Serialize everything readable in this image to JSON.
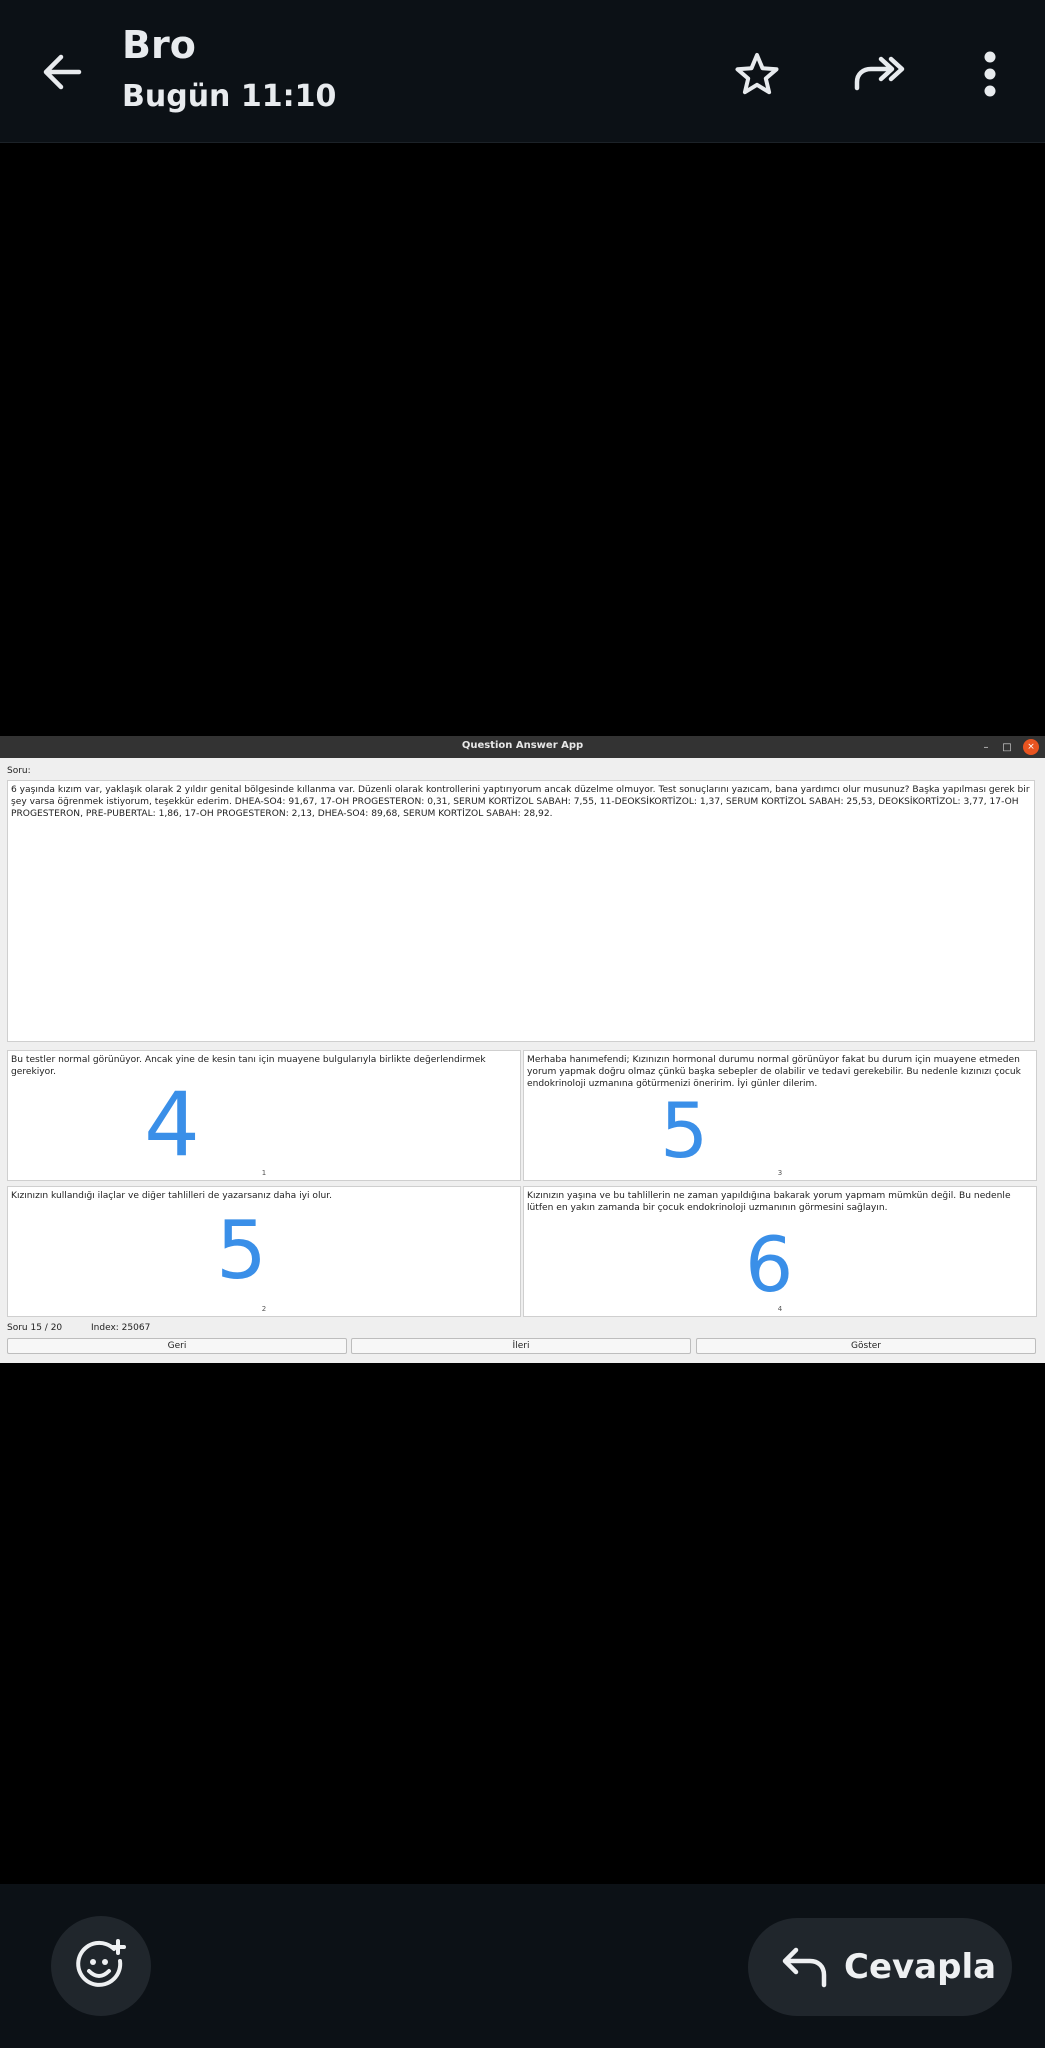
{
  "header": {
    "title": "Bro",
    "subtitle": "Bugün 11:10",
    "icons": [
      "back-arrow-icon",
      "star-icon",
      "forward-icon",
      "more-vertical-icon"
    ]
  },
  "app_window": {
    "title": "Question Answer App",
    "controls": [
      "–",
      "□",
      "×"
    ],
    "soru_label": "Soru:",
    "question_text": "6 yaşında kızım var, yaklaşık olarak 2 yıldır genital bölgesinde kıllanma var. Düzenli olarak kontrollerini yaptırıyorum ancak düzelme olmuyor. Test sonuçlarını yazıcam, bana yardımcı olur musunuz? Başka yapılması gerek bir şey varsa öğrenmek istiyorum, teşekkür ederim. DHEA-SO4: 91,67, 17-OH PROGESTERON: 0,31, SERUM KORTİZOL SABAH: 7,55, 11-DEOKSİKORTİZOL: 1,37, SERUM KORTİZOL SABAH: 25,53, DEOKSİKORTİZOL: 3,77, 17-OH PROGESTERON, PRE-PUBERTAL: 1,86, 17-OH PROGESTERON: 2,13, DHEA-SO4: 89,68, SERUM KORTİZOL SABAH: 28,92.",
    "answers": [
      {
        "text": "Bu testler normal görünüyor. Ancak yine de kesin tanı için muayene bulgularıyla birlikte değerlendirmek gerekiyor.",
        "number": "1",
        "score": "4"
      },
      {
        "text": "Kızınızın kullandığı ilaçlar ve diğer tahlilleri de yazarsanız daha iyi olur.",
        "number": "2",
        "score": "5"
      },
      {
        "text": "Merhaba hanımefendi; Kızınızın hormonal durumu normal görünüyor fakat bu durum için muayene etmeden yorum yapmak doğru olmaz çünkü başka sebepler de olabilir ve tedavi gerekebilir. Bu nedenle kızınızı çocuk endokrinoloji uzmanına götürmenizi öneririm. İyi günler dilerim.",
        "number": "3",
        "score": "5"
      },
      {
        "text": "Kızınızın yaşına ve bu tahlillerin ne zaman yapıldığına bakarak yorum yapmam mümkün değil. Bu nedenle lütfen en yakın zamanda bir çocuk endokrinoloji uzmanının görmesini sağlayın.",
        "number": "4",
        "score": "6"
      }
    ],
    "status": {
      "progress": "Soru 15 / 20",
      "index": "Index: 25067"
    },
    "buttons": {
      "back": "Geri",
      "next": "İleri",
      "show": "Göster"
    }
  },
  "footer": {
    "emoji_icon": "add-emoji-icon",
    "reply_icon": "reply-icon",
    "reply_label": "Cevapla"
  }
}
